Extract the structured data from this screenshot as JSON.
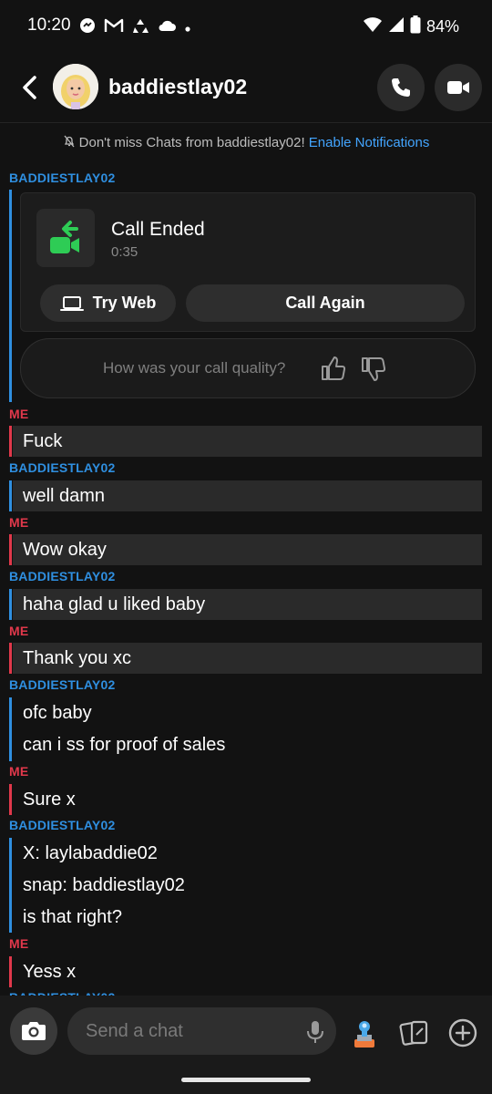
{
  "status_bar": {
    "time": "10:20",
    "battery": "84%"
  },
  "header": {
    "title": "baddiestlay02"
  },
  "notification": {
    "text": "Don't miss Chats from baddiestlay02!",
    "link": "Enable Notifications"
  },
  "sender_labels": {
    "them": "BADDIESTLAY02",
    "me": "ME"
  },
  "call_card": {
    "title": "Call Ended",
    "duration": "0:35",
    "try_web": "Try Web",
    "call_again": "Call Again",
    "quality_prompt": "How was your call quality?"
  },
  "messages": [
    {
      "from": "me",
      "texts": [
        "Fuck"
      ]
    },
    {
      "from": "them",
      "texts": [
        "well damn"
      ]
    },
    {
      "from": "me",
      "texts": [
        "Wow okay"
      ]
    },
    {
      "from": "them",
      "texts": [
        "haha glad u liked baby"
      ]
    },
    {
      "from": "me",
      "texts": [
        "Thank you xc"
      ]
    },
    {
      "from": "them",
      "texts": [
        "ofc baby",
        "can i ss for proof of sales"
      ]
    },
    {
      "from": "me",
      "texts": [
        "Sure x"
      ]
    },
    {
      "from": "them",
      "texts": [
        "X: laylabaddie02",
        "snap: baddiestlay02",
        "is that right?"
      ]
    },
    {
      "from": "me",
      "texts": [
        "Yess x"
      ]
    },
    {
      "from": "them",
      "texts": []
    }
  ],
  "input": {
    "placeholder": "Send a chat"
  },
  "colors": {
    "accent_them": "#2f8fe0",
    "accent_me": "#e0384b",
    "link": "#43a5ff",
    "call_green": "#2ecc55"
  }
}
